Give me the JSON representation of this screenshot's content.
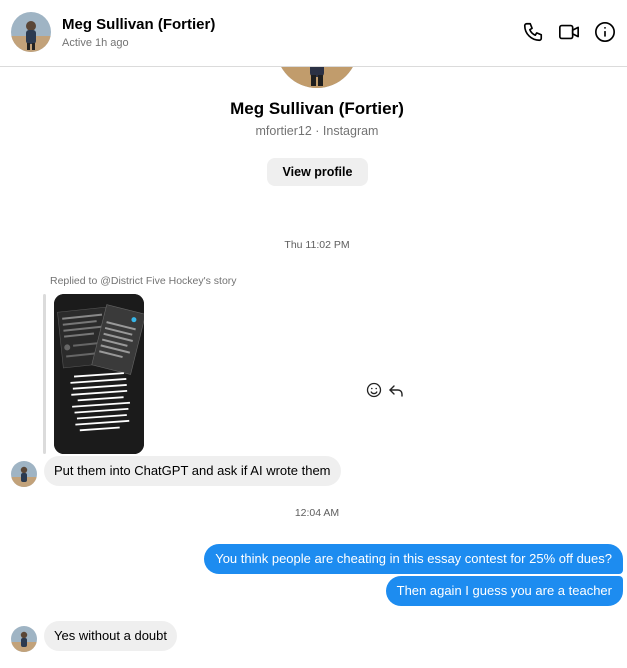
{
  "header": {
    "name": "Meg Sullivan (Fortier)",
    "status": "Active 1h ago",
    "icons": [
      "phone-icon",
      "video-icon",
      "info-icon"
    ]
  },
  "profile": {
    "name": "Meg Sullivan (Fortier)",
    "username_platform": "mfortier12 · Instagram",
    "view_profile_label": "View profile"
  },
  "thread": {
    "timestamp_1": "Thu 11:02 PM",
    "story_reply": {
      "label": "Replied to @District Five Hockey's story"
    },
    "message_1": "Put them into ChatGPT and ask if AI wrote them",
    "timestamp_2": "12:04 AM",
    "message_2": "You think people are cheating in this essay contest for 25% off dues?",
    "message_3": "Then again I guess you are a teacher",
    "message_4": "Yes without a doubt"
  },
  "colors": {
    "outgoing_bubble": "#1d8cf0",
    "incoming_bubble": "#efefef",
    "secondary_text": "#737373"
  }
}
